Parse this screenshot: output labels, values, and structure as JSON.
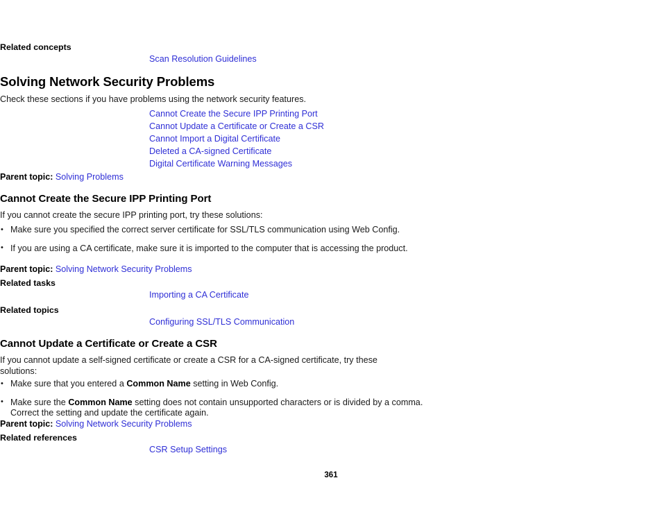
{
  "page": {
    "number": "361"
  },
  "related_concepts": {
    "heading": "Related concepts",
    "links": [
      {
        "label": "Scan Resolution Guidelines"
      }
    ]
  },
  "section_main": {
    "heading": "Solving Network Security Problems",
    "intro": "Check these sections if you have problems using the network security features.",
    "links": [
      {
        "label": "Cannot Create the Secure IPP Printing Port"
      },
      {
        "label": "Cannot Update a Certificate or Create a CSR"
      },
      {
        "label": "Cannot Import a Digital Certificate"
      },
      {
        "label": "Deleted a CA-signed Certificate"
      },
      {
        "label": "Digital Certificate Warning Messages"
      }
    ],
    "parent_topic": {
      "label": "Parent topic:",
      "link": "Solving Problems"
    }
  },
  "section_ipp": {
    "heading": "Cannot Create the Secure IPP Printing Port",
    "intro": "If you cannot create the secure IPP printing port, try these solutions:",
    "bullets": [
      {
        "text": "Make sure you specified the correct server certificate for SSL/TLS communication using Web Config."
      },
      {
        "text": "If you are using a CA certificate, make sure it is imported to the computer that is accessing the product."
      }
    ],
    "parent_topic": {
      "label": "Parent topic:",
      "link": "Solving Network Security Problems"
    },
    "related_tasks": {
      "heading": "Related tasks",
      "links": [
        {
          "label": "Importing a CA Certificate"
        }
      ]
    },
    "related_topics": {
      "heading": "Related topics",
      "links": [
        {
          "label": "Configuring SSL/TLS Communication"
        }
      ]
    }
  },
  "section_csr": {
    "heading": "Cannot Update a Certificate or Create a CSR",
    "intro": "If you cannot update a self-signed certificate or create a CSR for a CA-signed certificate, try these solutions:",
    "bullets": [
      {
        "before": "Make sure that you entered a ",
        "emphasis": "Common Name",
        "after": " setting in Web Config."
      },
      {
        "before": "Make sure the ",
        "emphasis": "Common Name",
        "after": " setting does not contain unsupported characters or is divided by a comma. Correct the setting and update the certificate again."
      }
    ],
    "parent_topic": {
      "label": "Parent topic:",
      "link": "Solving Network Security Problems"
    },
    "related_references": {
      "heading": "Related references",
      "links": [
        {
          "label": "CSR Setup Settings"
        }
      ]
    }
  },
  "colors": {
    "link": "#2f2fd6",
    "text": "#1a1a1a",
    "background": "#ffffff"
  }
}
